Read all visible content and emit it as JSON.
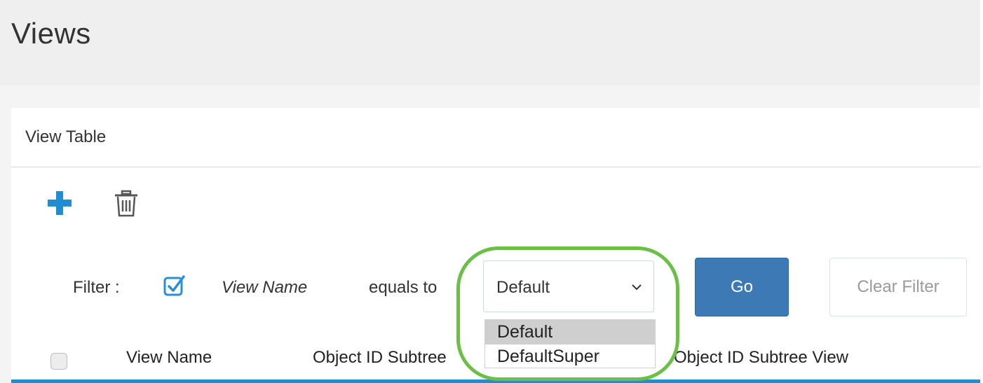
{
  "page": {
    "title": "Views"
  },
  "card": {
    "title": "View Table"
  },
  "toolbar": {
    "add_icon": "plus-icon",
    "delete_icon": "trash-icon"
  },
  "filter": {
    "label": "Filter :",
    "checked": true,
    "field": "View Name",
    "operator": "equals to",
    "selected_value": "Default",
    "options": [
      "Default",
      "DefaultSuper"
    ],
    "go_label": "Go",
    "clear_label": "Clear Filter"
  },
  "table": {
    "columns": [
      "View Name",
      "Object ID Subtree",
      "Object ID Subtree View"
    ]
  },
  "colors": {
    "accent_blue": "#3d7ab5",
    "plus_blue": "#1f8dd0",
    "highlight_green": "#6bbf47"
  }
}
